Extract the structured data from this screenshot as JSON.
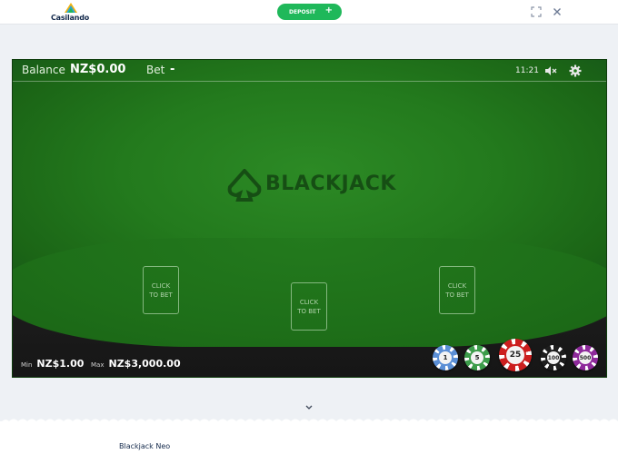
{
  "header": {
    "brand_name": "Casilando",
    "deposit_label": "DEPOSIT",
    "deposit_icon": "plus-icon",
    "fullscreen_icon": "fullscreen-icon",
    "close_icon": "close-icon"
  },
  "game": {
    "balance_label": "Balance",
    "balance_value": "NZ$0.00",
    "bet_label": "Bet",
    "bet_value": "-",
    "clock": "11:21",
    "sound_icon": "sound-muted-icon",
    "settings_icon": "gear-icon",
    "logo_text": "BLACKJACK",
    "bet_spots": [
      {
        "line1": "CLICK",
        "line2": "TO BET"
      },
      {
        "line1": "CLICK",
        "line2": "TO BET"
      },
      {
        "line1": "CLICK",
        "line2": "TO BET"
      }
    ],
    "min_label": "Min",
    "min_value": "NZ$1.00",
    "max_label": "Max",
    "max_value": "NZ$3,000.00",
    "chips": [
      {
        "value": "1",
        "color": "#5b8fd6"
      },
      {
        "value": "5",
        "color": "#3c9c4a"
      },
      {
        "value": "25",
        "color": "#cc1f1f",
        "selected": true
      },
      {
        "value": "100",
        "color": "#1e1e1e"
      },
      {
        "value": "500",
        "color": "#8e2a9b"
      }
    ]
  },
  "footer": {
    "expand_icon": "chevron-down-icon",
    "game_title": "Blackjack Neo"
  },
  "colors": {
    "felt": "#237a1d",
    "deposit_button": "#1fb85a",
    "brand_text": "#13294b"
  }
}
